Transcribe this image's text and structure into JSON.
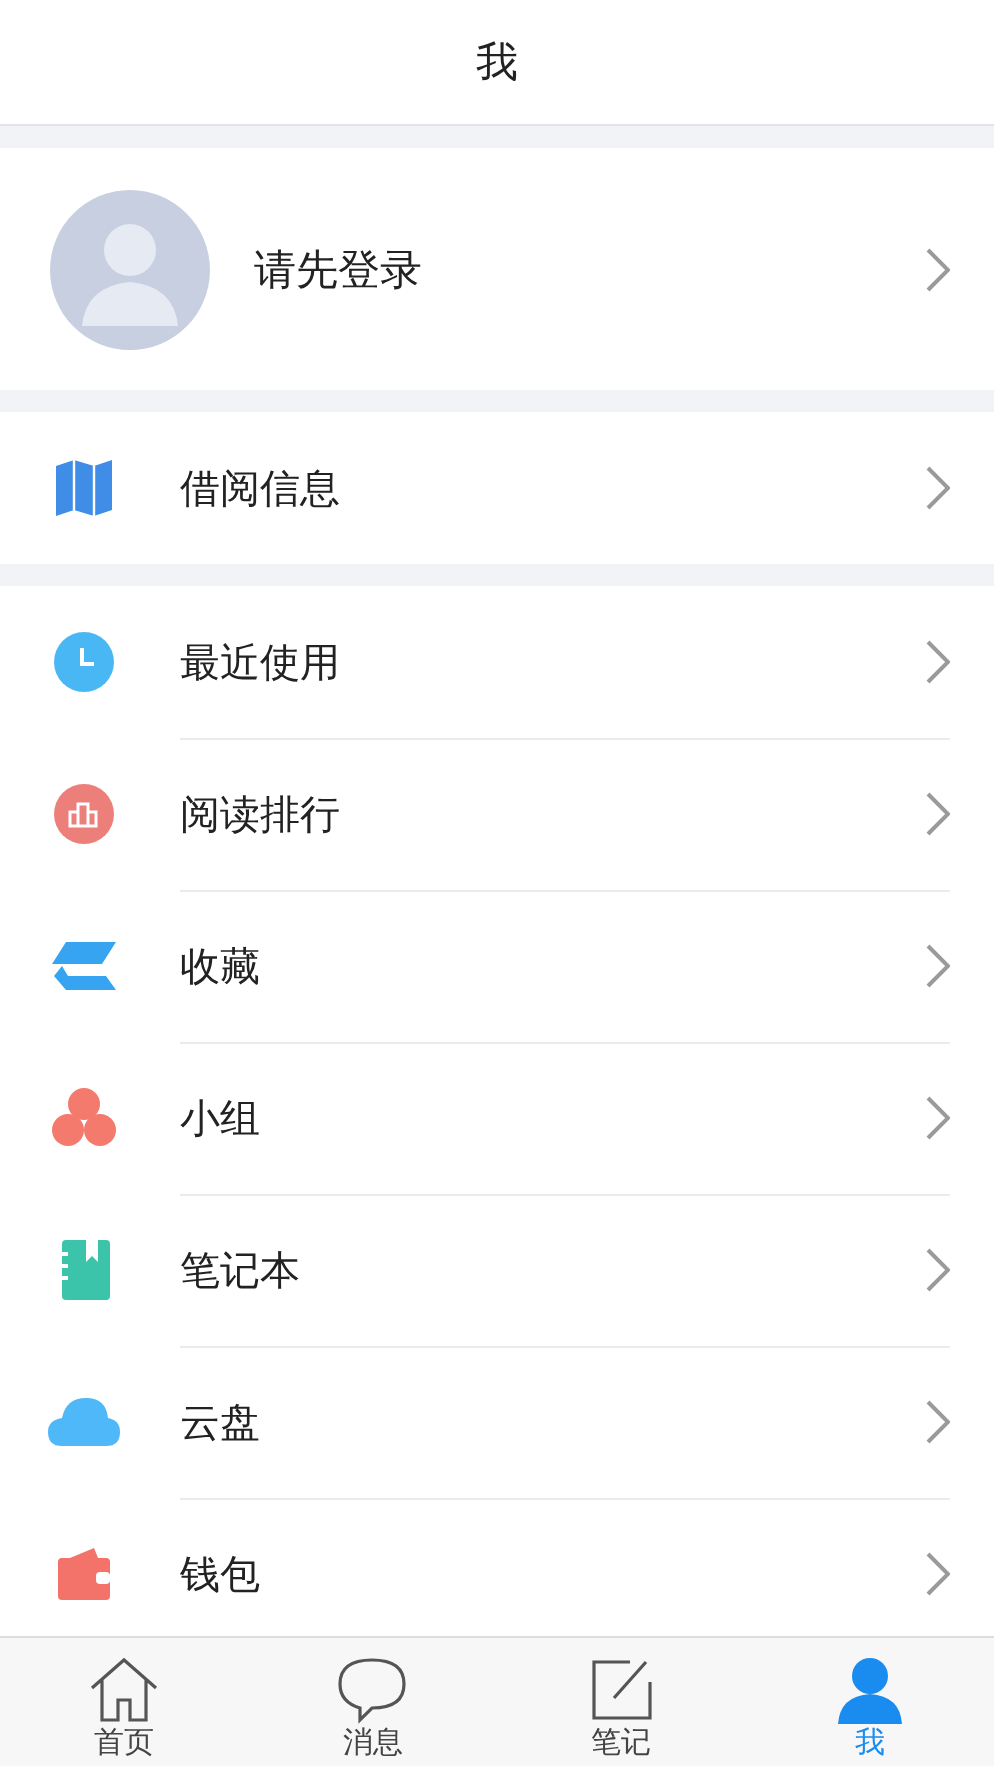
{
  "header": {
    "title": "我"
  },
  "profile": {
    "label": "请先登录"
  },
  "borrow": {
    "label": "借阅信息"
  },
  "menu": [
    {
      "label": "最近使用"
    },
    {
      "label": "阅读排行"
    },
    {
      "label": "收藏"
    },
    {
      "label": "小组"
    },
    {
      "label": "笔记本"
    },
    {
      "label": "云盘"
    },
    {
      "label": "钱包"
    }
  ],
  "tabs": [
    {
      "label": "首页",
      "selected": false
    },
    {
      "label": "消息",
      "selected": false
    },
    {
      "label": "笔记",
      "selected": false
    },
    {
      "label": "我",
      "selected": true
    }
  ]
}
